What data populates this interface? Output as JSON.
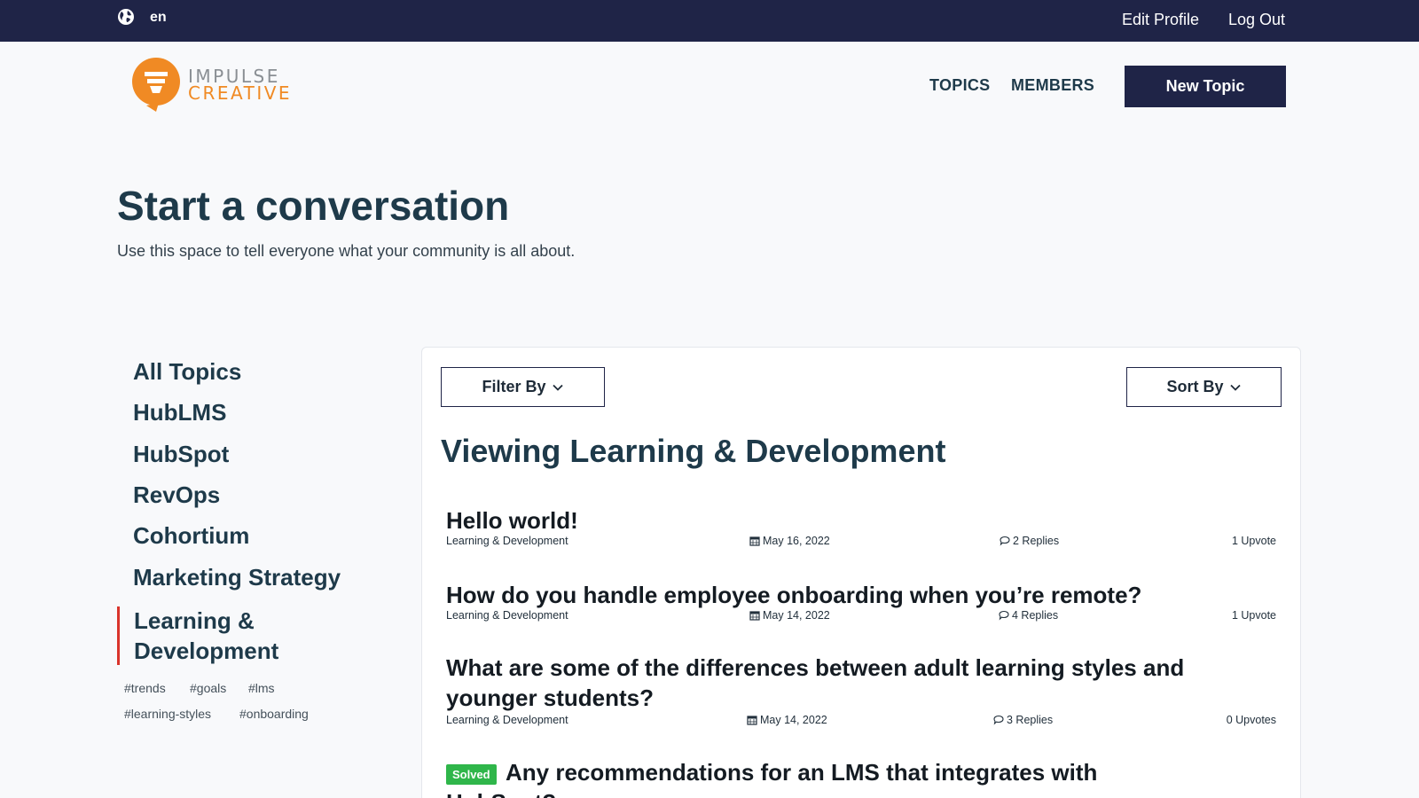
{
  "topbar": {
    "language": "en",
    "edit_profile": "Edit Profile",
    "log_out": "Log Out",
    "background": "#1f2447"
  },
  "brand": {
    "line1": "IMPULSE",
    "line2": "CREATIVE",
    "accent": "#f08a24"
  },
  "nav": {
    "topics": "TOPICS",
    "members": "MEMBERS",
    "new_topic": "New Topic"
  },
  "hero": {
    "title": "Start a conversation",
    "subtitle": "Use this space to tell everyone what your community is all about."
  },
  "sidebar": {
    "categories": [
      "All Topics",
      "HubLMS",
      "HubSpot",
      "RevOps",
      "Cohortium",
      "Marketing Strategy"
    ],
    "active_line1": "Learning &",
    "active_line2": "Development",
    "active_marker_color": "#d9342b",
    "tags": [
      "#trends",
      "#goals",
      "#lms",
      "#learning-styles",
      "#onboarding"
    ]
  },
  "main": {
    "filter_label": "Filter By",
    "sort_label": "Sort By",
    "viewing": "Viewing Learning & Development",
    "topics": [
      {
        "title": "Hello world!",
        "category": "Learning & Development",
        "date": "May 16, 2022",
        "replies": "2 Replies",
        "upvotes": "1 Upvote"
      },
      {
        "title": "How do you handle employee onboarding when you’re remote?",
        "category": "Learning & Development",
        "date": "May 14, 2022",
        "replies": "4 Replies",
        "upvotes": "1 Upvote"
      },
      {
        "title_line1": "What are some of the differences between adult learning styles and",
        "title_line2": "younger students?",
        "category": "Learning & Development",
        "date": "May 14, 2022",
        "replies": "3 Replies",
        "upvotes": "0 Upvotes"
      },
      {
        "badge": "Solved",
        "badge_color": "#2fb64a",
        "title_line1": "Any recommendations for an LMS that integrates with",
        "title_line2": "HubSpot?"
      }
    ]
  }
}
